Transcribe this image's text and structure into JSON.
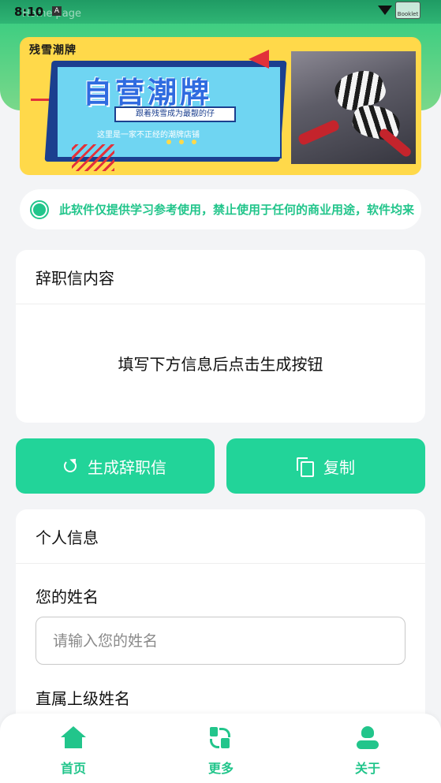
{
  "status_bar": {
    "time": "8:10",
    "page_hint": "Home page",
    "badge": "A",
    "battery_label": "Booklet"
  },
  "banner": {
    "brand": "残雪潮牌",
    "title": "自营潮牌",
    "subtitle": "跟着残雪成为最靓的仔",
    "tagline": "这里是一家不正经的潮牌店铺"
  },
  "notice": {
    "text": "此软件仅提供学习参考使用，禁止使用于任何的商业用途，软件均来"
  },
  "letter_card": {
    "title": "辞职信内容",
    "placeholder": "填写下方信息后点击生成按钮"
  },
  "actions": {
    "generate_label": "生成辞职信",
    "copy_label": "复制"
  },
  "info_card": {
    "title": "个人信息",
    "name_label": "您的姓名",
    "name_placeholder": "请输入您的姓名",
    "name_value": "",
    "boss_label": "直属上级姓名"
  },
  "nav": {
    "home": "首页",
    "more": "更多",
    "about": "关于"
  },
  "colors": {
    "accent": "#22d499",
    "accent_text": "#22c58b",
    "header_green": "#2fcb7f",
    "banner_yellow": "#ffd94a"
  }
}
